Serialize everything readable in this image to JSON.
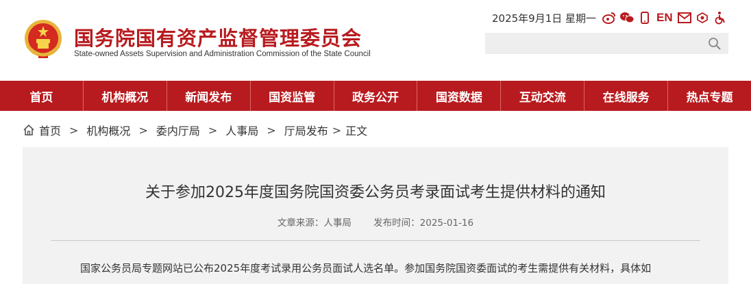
{
  "header": {
    "site_name_cn": "国务院国有资产监督管理委员会",
    "site_name_en": "State-owned Assets Supervision and Administration Commission of the State Council",
    "date": "2025年9月1日 星期一",
    "en_link": "EN",
    "icons": [
      "weibo-icon",
      "wechat-icon",
      "mobile-icon",
      "mail-icon",
      "accessibility-icon",
      "wheelchair-icon"
    ],
    "search_placeholder": ""
  },
  "nav": {
    "items": [
      "首页",
      "机构概况",
      "新闻发布",
      "国资监管",
      "政务公开",
      "国资数据",
      "互动交流",
      "在线服务",
      "热点专题"
    ]
  },
  "breadcrumb": {
    "items": [
      "首页",
      "机构概况",
      "委内厅局",
      "人事局",
      "厅局发布"
    ],
    "current": "正文",
    "separator": ">"
  },
  "article": {
    "title": "关于参加2025年度国务院国资委公务员考录面试考生提供材料的通知",
    "source": "文章来源：人事局",
    "publish_time": "发布时间：2025-01-16",
    "first_line": "国家公务员局专题网站已公布2025年度考试录用公务员面试人选名单。参加国务院国资委面试的考生需提供有关材料，具体如"
  },
  "colors": {
    "brand_red": "#b81b1f",
    "article_bg": "#f2f2f2",
    "search_bg": "#eeeeee"
  }
}
